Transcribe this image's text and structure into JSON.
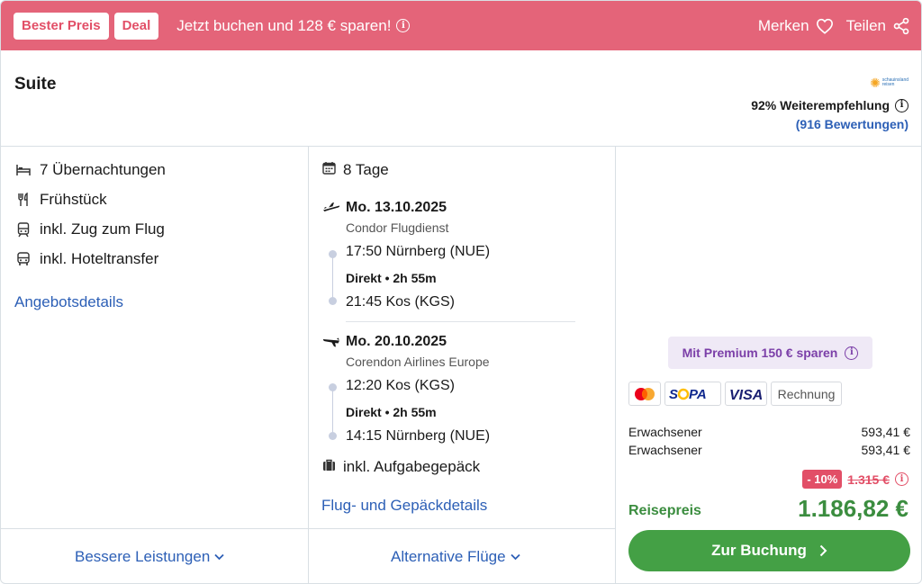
{
  "banner": {
    "badge_best_price": "Bester Preis",
    "badge_deal": "Deal",
    "promo_text": "Jetzt buchen und 128 € sparen!",
    "save_label": "Merken",
    "share_label": "Teilen",
    "color": "#e46479"
  },
  "offer": {
    "room_title": "Suite",
    "tour_operator_logo": "schauinsland reisen",
    "recommendation": "92% Weiterempfehlung",
    "reviews": "(916 Bewertungen)"
  },
  "features": {
    "items": [
      {
        "icon": "bed-icon",
        "label": "7 Übernachtungen"
      },
      {
        "icon": "cutlery-icon",
        "label": "Frühstück"
      },
      {
        "icon": "train-icon",
        "label": "inkl. Zug zum Flug"
      },
      {
        "icon": "bus-icon",
        "label": "inkl. Hoteltransfer"
      }
    ],
    "details_link": "Angebotsdetails"
  },
  "flights": {
    "duration": "8 Tage",
    "outbound": {
      "date": "Mo. 13.10.2025",
      "airline": "Condor Flugdienst",
      "departure": "17:50 Nürnberg (NUE)",
      "info": "Direkt • 2h 55m",
      "arrival": "21:45 Kos (KGS)"
    },
    "return": {
      "date": "Mo. 20.10.2025",
      "airline": "Corendon Airlines Europe",
      "departure": "12:20 Kos (KGS)",
      "info": "Direkt • 2h 55m",
      "arrival": "14:15 Nürnberg (NUE)"
    },
    "luggage": "inkl. Aufgabegepäck",
    "details_link": "Flug- und Gepäckdetails"
  },
  "tabs": {
    "better_services": "Bessere Leistungen",
    "alternative_flights": "Alternative Flüge"
  },
  "pricing": {
    "premium": "Mit Premium 150 € sparen",
    "payment_methods": [
      "Mastercard",
      "SEPA",
      "VISA",
      "Rechnung"
    ],
    "rows": [
      {
        "label": "Erwachsener",
        "value": "593,41 €"
      },
      {
        "label": "Erwachsener",
        "value": "593,41 €"
      }
    ],
    "discount": "- 10%",
    "old_price": "1.315 €",
    "total_label": "Reisepreis",
    "total_value": "1.186,82 €",
    "book_button": "Zur Buchung",
    "accent_green": "#44a045"
  }
}
